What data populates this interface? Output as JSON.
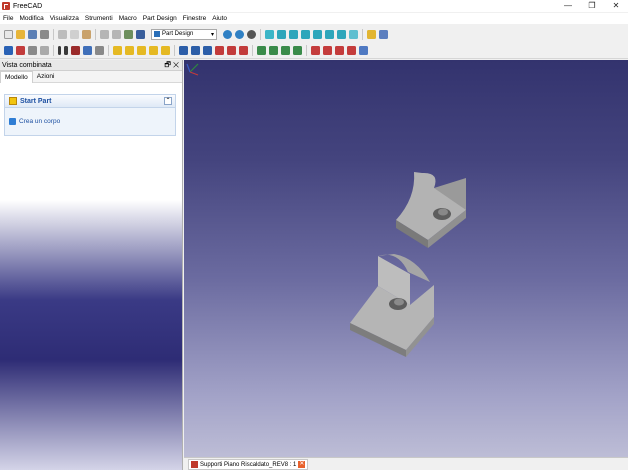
{
  "window": {
    "title": "FreeCAD",
    "minimize": "—",
    "maximize": "❐",
    "close": "✕"
  },
  "menu": [
    "File",
    "Modifica",
    "Visualizza",
    "Strumenti",
    "Macro",
    "Part Design",
    "Finestre",
    "Aiuto"
  ],
  "toolbar": {
    "workbench": "Part Design",
    "workbench_arrow": "▾"
  },
  "panel": {
    "title": "Vista combinata",
    "controls": "🗗 ✕",
    "tabs": [
      "Modello",
      "Azioni"
    ],
    "task": {
      "title": "Start Part",
      "collapse": "⌃",
      "link": "Crea un corpo"
    }
  },
  "document_tab": {
    "label": "Supporti Piano Riscaldato_REV8 : 1",
    "close": "✕"
  },
  "colors": {
    "viewport_top": "#33336e",
    "viewport_bottom": "#bdbdd6",
    "part": "#a9a9a9",
    "link": "#1c4fa1"
  },
  "icons": [
    "freecad-logo-icon",
    "new-file-icon",
    "open-icon",
    "save-icon",
    "print-icon",
    "cut-icon",
    "copy-icon",
    "paste-icon",
    "undo-icon",
    "redo-icon",
    "refresh-icon",
    "whats-this-icon",
    "zoom-icon",
    "view-cube-icons",
    "body-icon",
    "sketch-icon",
    "pad-icon",
    "pocket-icon",
    "fillet-icon",
    "axis-icon"
  ]
}
